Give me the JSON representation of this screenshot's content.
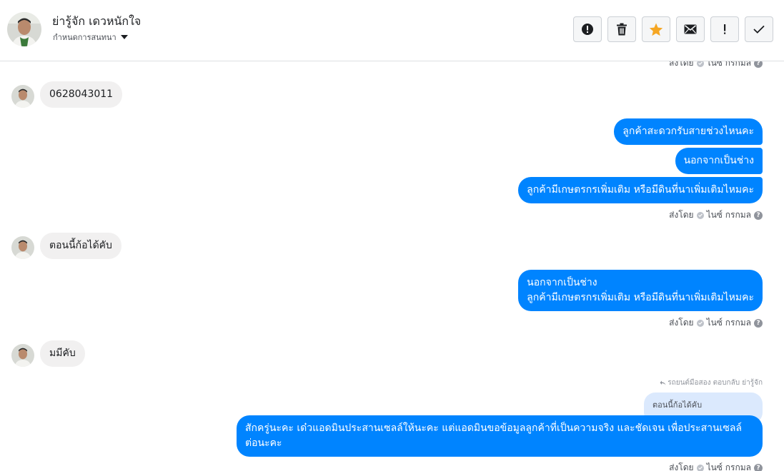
{
  "header": {
    "name": "ย่ารู้จัก เดวหนักใจ",
    "subtitle": "กำหนดการสนทนา",
    "actions": [
      {
        "name": "report-icon",
        "label": "!"
      },
      {
        "name": "trash-icon"
      },
      {
        "name": "star-icon",
        "color": "#f5a623"
      },
      {
        "name": "envelope-icon"
      },
      {
        "name": "exclamation-icon",
        "label": "!"
      },
      {
        "name": "checkmark-icon"
      }
    ]
  },
  "thread": {
    "top_seen": {
      "prefix": "ส่งโดย",
      "by": "ไนซ์ กรกมล",
      "help": "?"
    },
    "messages_in": [
      {
        "text": "0628043011"
      },
      {
        "text": "ตอนนี้ก้อได้คับ"
      },
      {
        "text": "มมีคับ"
      }
    ],
    "group1": [
      {
        "text": "ลูกค้าสะดวกรับสายช่วงไหนคะ"
      },
      {
        "text": "นอกจากเป็นช่าง"
      },
      {
        "text": "ลูกค้ามีเกษตรกรเพิ่มเติม หรือมีดินที่นาเพิ่มเติมไหมคะ"
      }
    ],
    "seen1": {
      "prefix": "ส่งโดย",
      "by": "ไนซ์ กรกมล",
      "help": "?"
    },
    "group2": {
      "line1": "นอกจากเป็นช่าง",
      "line2": "ลูกค้ามีเกษตรกรเพิ่มเติม หรือมีดินที่นาเพิ่มเติมไหมคะ"
    },
    "seen2": {
      "prefix": "ส่งโดย",
      "by": "ไนซ์ กรกมล",
      "help": "?"
    },
    "reply": {
      "meta": "รถยนต์มือสอง ตอบกลับ ย่ารู้จัก",
      "quoted": "ตอนนี้ก้อได้คับ",
      "text": "สักครู่นะคะ เด๋วแอดมินประสานเซลล์ให้นะคะ แต่แอดมินขอข้อมูลลูกค้าที่เป็นความจริง และชัดเจน เพื่อประสานเซลล์ต่อนะคะ"
    },
    "seen3": {
      "prefix": "ส่งโดย",
      "by": "ไนซ์ กรกมล",
      "help": "?"
    }
  },
  "colors": {
    "outgoing_bubble": "#0084ff",
    "incoming_bubble": "#f1f0f0",
    "quoted_bubble": "#dbe9fd",
    "star": "#f5a623"
  }
}
